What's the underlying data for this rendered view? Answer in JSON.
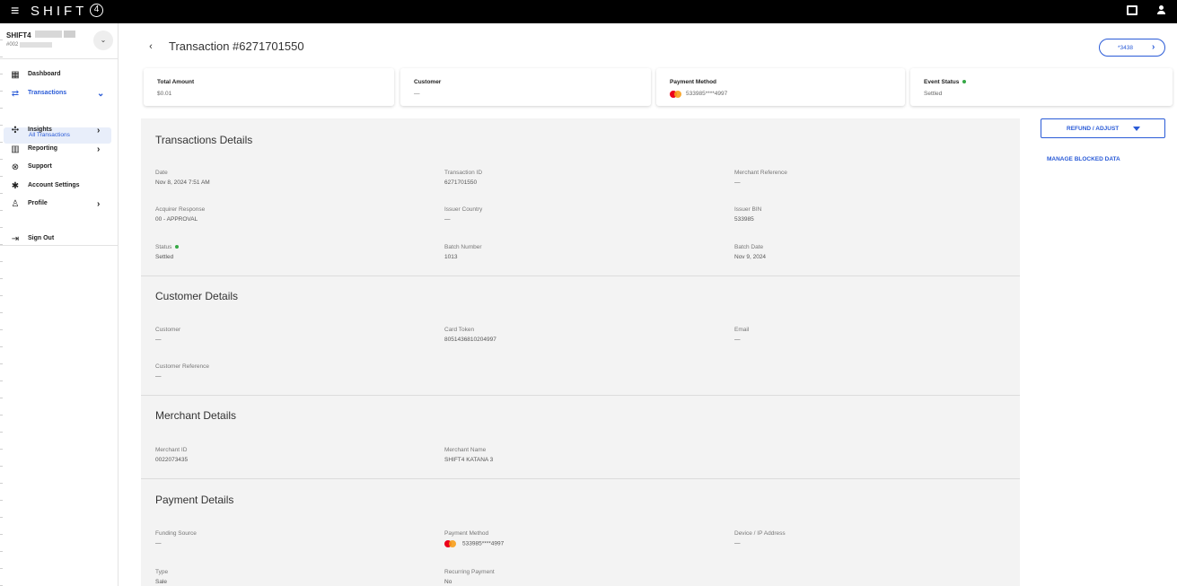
{
  "topbar": {
    "menu_icon": "hamburger-icon",
    "logo_text": "SHIFT",
    "logo_digit": "4"
  },
  "sidebar": {
    "account_name": "SHIFT4",
    "account_number": "#002",
    "items": [
      {
        "label": "Dashboard",
        "icon": "dashboard-icon"
      },
      {
        "label": "Transactions",
        "icon": "transfer-icon",
        "active": true
      },
      {
        "label": "Insights",
        "icon": "insights-icon"
      },
      {
        "label": "Reporting",
        "icon": "reporting-icon"
      },
      {
        "label": "Support",
        "icon": "support-icon"
      },
      {
        "label": "Account Settings",
        "icon": "settings-icon"
      },
      {
        "label": "Profile",
        "icon": "profile-icon"
      },
      {
        "label": "Sign Out",
        "icon": "sign-out-icon"
      }
    ],
    "sub_item": "All Transactions"
  },
  "header": {
    "title": "Transaction #6271701550",
    "card_pill": "*3438"
  },
  "summary": [
    {
      "title": "Total Amount",
      "value": "$0.01"
    },
    {
      "title": "Customer",
      "value": "—"
    },
    {
      "title": "Payment Method",
      "value": "533985****4997"
    },
    {
      "title": "Event Status",
      "value": "Settled"
    }
  ],
  "sections": {
    "transaction": {
      "title": "Transactions Details",
      "fields": [
        {
          "label": "Date",
          "value": "Nov 8, 2024 7:51 AM"
        },
        {
          "label": "Transaction ID",
          "value": "6271701550"
        },
        {
          "label": "Merchant Reference",
          "value": "—"
        },
        {
          "label": "Acquirer Response",
          "value": "00 - APPROVAL"
        },
        {
          "label": "Issuer Country",
          "value": "—"
        },
        {
          "label": "Issuer BIN",
          "value": "533985"
        },
        {
          "label": "Status",
          "value": "Settled"
        },
        {
          "label": "Batch Number",
          "value": "1013"
        },
        {
          "label": "Batch Date",
          "value": "Nov 9, 2024"
        }
      ]
    },
    "customer": {
      "title": "Customer Details",
      "fields": [
        {
          "label": "Customer",
          "value": "—"
        },
        {
          "label": "Card Token",
          "value": "8051436810204997"
        },
        {
          "label": "Email",
          "value": "—"
        },
        {
          "label": "Customer Reference",
          "value": "—"
        }
      ]
    },
    "merchant": {
      "title": "Merchant Details",
      "fields": [
        {
          "label": "Merchant ID",
          "value": "0022073435"
        },
        {
          "label": "Merchant Name",
          "value": "SHIFT4 KATANA 3"
        }
      ]
    },
    "payment": {
      "title": "Payment Details",
      "fields": [
        {
          "label": "Funding Source",
          "value": "—"
        },
        {
          "label": "Payment Method",
          "value": "533985****4997"
        },
        {
          "label": "Device / IP Address",
          "value": "—"
        },
        {
          "label": "Type",
          "value": "Sale"
        },
        {
          "label": "Recurring Payment",
          "value": "No"
        }
      ]
    }
  },
  "actions": {
    "refund_label": "REFUND / ADJUST",
    "manage_label": "MANAGE BLOCKED DATA"
  },
  "colors": {
    "accent": "#2a5bd7",
    "status_green": "#35a845",
    "panel_bg": "#f3f3f3"
  }
}
